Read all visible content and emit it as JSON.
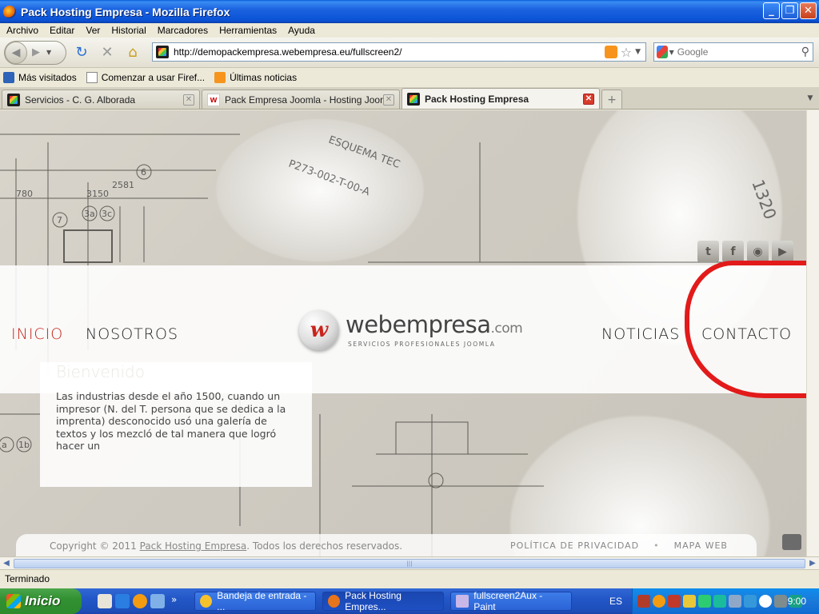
{
  "window": {
    "title": "Pack Hosting Empresa - Mozilla Firefox"
  },
  "menu": [
    "Archivo",
    "Editar",
    "Ver",
    "Historial",
    "Marcadores",
    "Herramientas",
    "Ayuda"
  ],
  "navbar": {
    "url": "http://demopackempresa.webempresa.eu/fullscreen2/",
    "search_placeholder": "Google"
  },
  "bookmarks": [
    {
      "label": "Más visitados",
      "icon": "bookmark-folder-icon"
    },
    {
      "label": "Comenzar a usar Firef...",
      "icon": "page-icon"
    },
    {
      "label": "Últimas noticias",
      "icon": "rss-icon"
    }
  ],
  "tabs": [
    {
      "label": "Servicios - C. G. Alborada",
      "icon": "joomla-icon",
      "active": false
    },
    {
      "label": "Pack Empresa Joomla - Hosting Joomla",
      "icon": "webempresa-icon",
      "active": false
    },
    {
      "label": "Pack Hosting Empresa",
      "icon": "joomla-icon",
      "active": true
    }
  ],
  "site": {
    "nav": {
      "inicio": "INICIO",
      "nosotros": "NOSOTROS",
      "noticias": "NOTICIAS",
      "contacto": "CONTACTO"
    },
    "logo": {
      "mark": "w",
      "brand": "webempresa",
      "suffix": ".com",
      "tagline": "SERVICIOS PROFESIONALES JOOMLA"
    },
    "social": [
      "twitter-icon",
      "facebook-icon",
      "rss-icon",
      "youtube-icon"
    ],
    "welcome": {
      "title": "Bienvenido",
      "body": "Las industrias desde el año 1500, cuando un impresor (N. del T. persona que se dedica a la imprenta) desconocido usó una galería de textos y los mezcló de tal manera que logró hacer un"
    },
    "footer": {
      "copy_prefix": "Copyright © 2011 ",
      "copy_link": "Pack Hosting Empresa",
      "copy_suffix": ". Todos los derechos reservados.",
      "privacy": "POLÍTICA DE PRIVACIDAD",
      "sitemap": "MAPA WEB"
    }
  },
  "statusbar": {
    "text": "Terminado"
  },
  "taskbar": {
    "start": "Inicio",
    "tasks": [
      {
        "label": "Bandeja de entrada - ...",
        "active": false
      },
      {
        "label": "Pack Hosting Empres...",
        "active": true
      },
      {
        "label": "fullscreen2Aux - Paint",
        "active": false
      }
    ],
    "lang": "ES",
    "clock": "9:00"
  },
  "colors": {
    "accent_red": "#c8241c",
    "annotation_red": "#e21a1a"
  }
}
